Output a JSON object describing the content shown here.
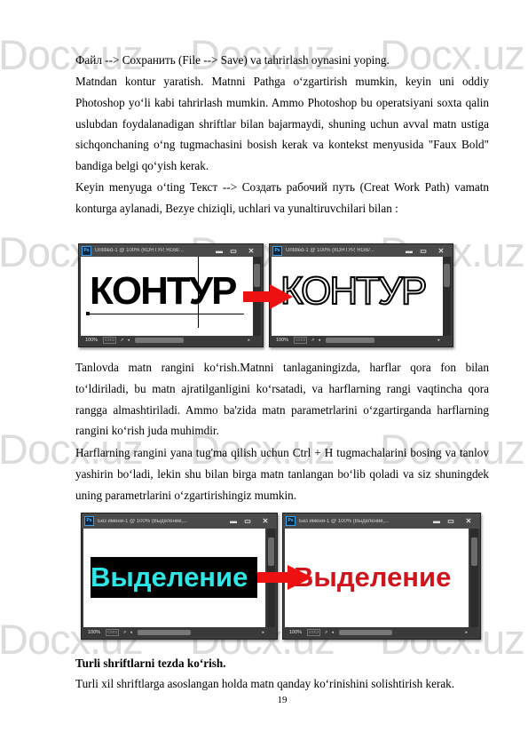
{
  "watermark": {
    "text": "Docx.uz"
  },
  "paragraphs": {
    "p1": "Файл --> Сохранить (File --> Save) va tahrirlash oynasini yoping.",
    "p2": "Matndan kontur yaratish. Matnni Pathga o‘zgartirish mumkin, keyin uni oddiy Photoshop yo‘li kabi tahrirlash mumkin. Ammo Photoshop bu operatsiyani soxta qalin uslubdan foydalanadigan shriftlar bilan bajarmaydi, shuning uchun avval matn ustiga sichqonchaning o‘ng tugmachasini bosish kerak va kontekst menyusida \"Faux Bold\" bandiga belgi qo‘yish kerak.",
    "p3": "Keyin menyuga o‘ting Текст --> Создать рабочий путь (Creat Work Path) vamatn konturga aylanadi, Bezye chiziqli, uchlari va yunaltiruvchilari bilan  :",
    "p4": "Tanlovda matn rangini ko‘rish.Matnni tanlaganingizda, harflar qora fon bilan to‘ldiriladi, bu matn ajratilganligini ko‘rsatadi, va harflarning rangi vaqtincha qora rangga almashtiriladi. Ammo ba'zida matn parametrlarini o‘zgartirganda harflarning rangini ko‘rish juda muhimdir.",
    "p5": "Harflarning rangini yana tug'ma qilish uchun Ctrl + H tugmachalarini bosing va tanlov yashirin bo‘ladi, lekin shu bilan birga matn tanlangan bo‘lib qoladi va siz shuningdek uning parametrlarini o‘zgartirishingiz mumkin.",
    "heading": "Turli shriftlarni tezda ko‘rish.",
    "p6": "Turli xil shriftlarga asoslangan holda matn qanday ko‘rinishini solishtirish kerak."
  },
  "figure1": {
    "left_window": {
      "logo": "Ps",
      "title": "Untitled-1 @ 100% (КОНТУР, RGB/...",
      "canvas_text": "КОНТУР",
      "zoom": "100%"
    },
    "right_window": {
      "logo": "Ps",
      "title": "Untitled-1 @ 100% (КОНТУР, RGB/...",
      "canvas_text": "КОНТУР",
      "zoom": "100%"
    },
    "controls": {
      "minimize": "▬",
      "maximize": "▭",
      "close": "✕"
    }
  },
  "figure2": {
    "left_window": {
      "logo": "Ps",
      "title": "Без имени-1 @ 100% (Выделение,...",
      "canvas_text": "Выделение",
      "zoom": "100%"
    },
    "right_window": {
      "logo": "Ps",
      "title": "Без имени-1 @ 100% (Выделение,...",
      "canvas_text": "Выделение",
      "zoom": "100%"
    },
    "controls": {
      "minimize": "▬",
      "maximize": "▭",
      "close": "✕"
    }
  },
  "status_icons": {
    "info": "▭▭",
    "export": "⇗",
    "left_arrow": "◂",
    "right_arrow": "▸"
  },
  "colors": {
    "arrow": "#ee1111",
    "selection_text": "#2ee6e6",
    "selection_bg": "#000000",
    "red_text": "#d0141e"
  },
  "page_number": "19"
}
